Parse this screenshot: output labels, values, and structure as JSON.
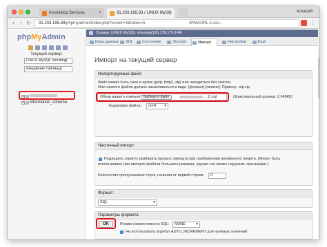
{
  "browser": {
    "username": "Алексей",
    "tabs": [
      {
        "title": "Inoventica Services",
        "close": "×"
      },
      {
        "title": "91.203.195.83 / LINUX MySQ",
        "close": "×"
      }
    ],
    "url_host": "91.203.195.83",
    "url_path": "/phpmyadmin/index.php?server=4&token=5",
    "url_tail": "#PMAURL-1:ser...",
    "nav": {
      "back": "‹",
      "forward": "›",
      "reload": "↻",
      "menu": "⋮"
    }
  },
  "left": {
    "logo_php": "php",
    "logo_my": "My",
    "logo_admin": "Admin",
    "server_label": "Текущий сервер:",
    "server_value": "LINUX MySQL vhosting(",
    "table_select": "(Недавние таблицы) ...",
    "databases": [
      {
        "name": "",
        "expander": "+"
      },
      {
        "name": "information_schema",
        "expander": "+"
      }
    ]
  },
  "main": {
    "serverbar": "Сервер: LINUX MySQL vhosting(195.178.170.144)",
    "tabs": [
      {
        "label": "Базы данных"
      },
      {
        "label": "SQL"
      },
      {
        "label": "Состояние"
      },
      {
        "label": "Экспорт"
      },
      {
        "label": "Импорт"
      },
      {
        "label": "Настройки"
      },
      {
        "label": "Ещё"
      }
    ],
    "title": "Импорт на текущий сервер",
    "import_file": {
      "legend": "Импортируемый файл:",
      "line1": "Файл может быть сжат в архив (gzip, bzip2, zip) или находиться без сжатия.",
      "line2": "Имя сжатого файла должно заканчиваться в виде .[формат].[сжатие]. Пример: .sql.zip",
      "browse_label": "Обзор вашего компьютера:",
      "browse_button": "Выберите файл",
      "file_name": "...1).sql",
      "max_size": "(Максимальный размер: 2,048КБ)",
      "charset_label": "Кодировка файла:",
      "charset_value": "utf-8"
    },
    "partial": {
      "legend": "Частичный импорт:",
      "line1": "Разрешить скрипту разбивать процесс импорта при приближении временного лимита. (Может быть",
      "line2": "использовано при импорте файлов большого размера, однако это может нарушить транзакции.)",
      "skip_label": "Количество пропускаемых строк, начиная от первой строки:",
      "skip_value": "0"
    },
    "format": {
      "legend": "Формат:",
      "value": "SQL"
    },
    "params": {
      "legend": "Параметры формата:",
      "compat_label": "Режим совместимости SQL:",
      "compat_value": "NONE",
      "autoinc_label": "Не использовать атрибут AUTO_INCREMENT для нулевых значений"
    },
    "ok_button": "OK"
  }
}
